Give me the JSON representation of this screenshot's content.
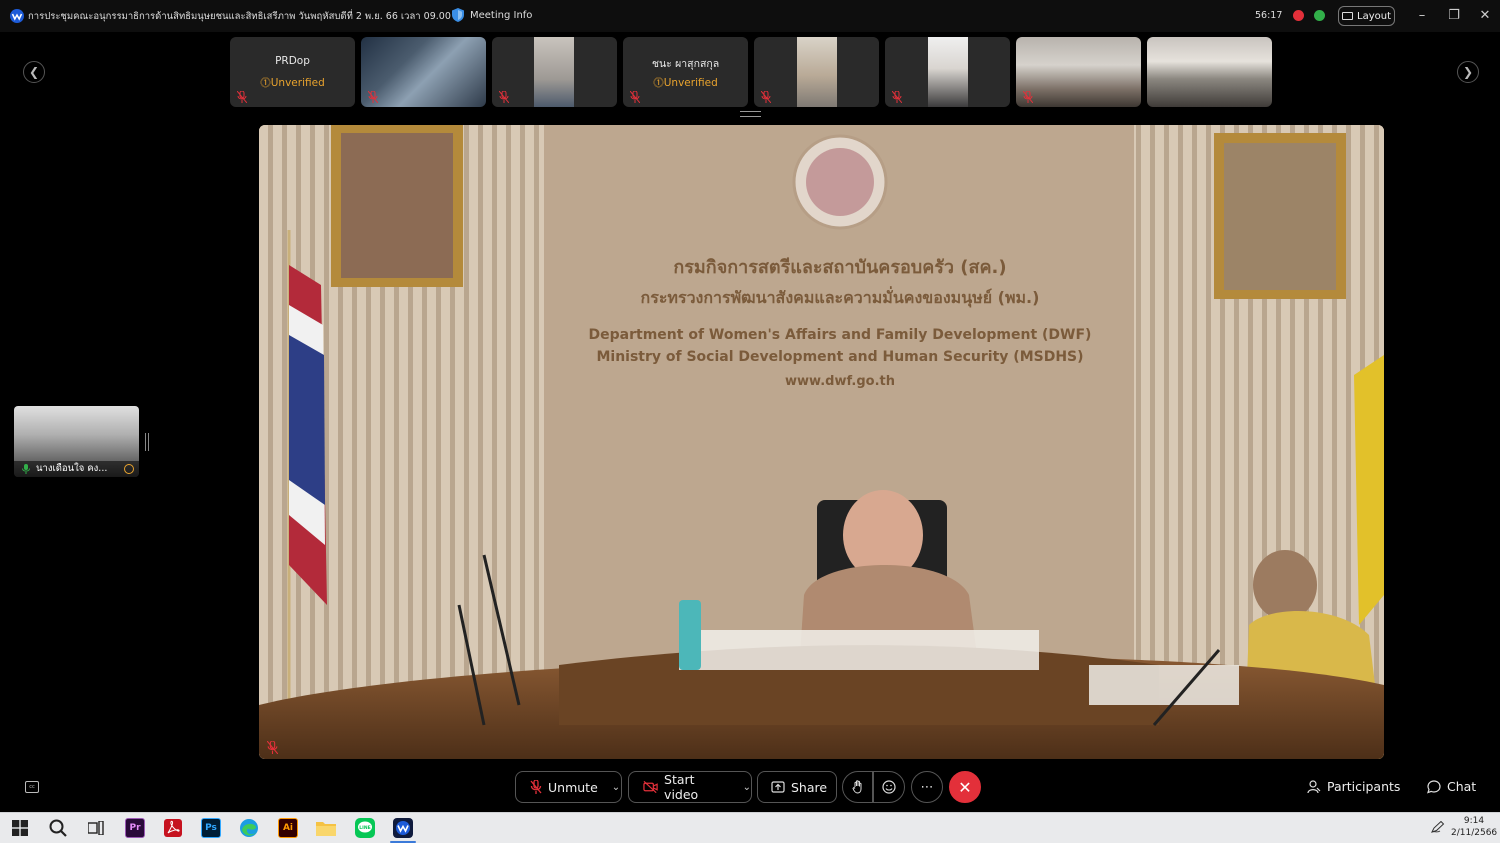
{
  "window": {
    "title": "การประชุมคณะอนุกรรมาธิการด้านสิทธิมนุษยชนและสิทธิเสรีภาพ วันพฤหัสบดีที่ 2 พ.ย. 66 เวลา 09.00 น.",
    "meeting_info_label": "Meeting Info",
    "timer": "56:17",
    "layout_label": "Layout",
    "controls": {
      "minimize": "–",
      "maximize": "❐",
      "close": "✕"
    }
  },
  "thumbnails": [
    {
      "name": "PRDop",
      "status": "Unverified",
      "has_video": false
    },
    {
      "name": "",
      "status": "",
      "has_video": true
    },
    {
      "name": "",
      "status": "",
      "has_video": true
    },
    {
      "name": "ชนะ ผาสุกสกุล",
      "status": "Unverified",
      "has_video": false
    },
    {
      "name": "",
      "status": "",
      "has_video": true
    },
    {
      "name": "",
      "status": "",
      "has_video": true
    },
    {
      "name": "",
      "status": "",
      "has_video": true
    },
    {
      "name": "",
      "status": "",
      "has_video": true
    }
  ],
  "self_view": {
    "name": "นางเดือนใจ คง..."
  },
  "main_video": {
    "sign_line_1": "กรมกิจการสตรีและสถาบันครอบครัว (สค.)",
    "sign_line_2": "กระทรวงการพัฒนาสังคมและความมั่นคงของมนุษย์ (พม.)",
    "sign_line_3": "Department of Women's Affairs and Family Development (DWF)",
    "sign_line_4": "Ministry of Social Development and Human Security (MSDHS)",
    "sign_line_5": "www.dwf.go.th"
  },
  "controls": {
    "unmute": "Unmute",
    "start_video": "Start video",
    "share": "Share",
    "participants": "Participants",
    "chat": "Chat",
    "cc": "cc"
  },
  "taskbar": {
    "time": "9:14",
    "date": "2/11/2566",
    "apps": [
      {
        "name": "start-icon",
        "label": ""
      },
      {
        "name": "search-icon",
        "label": ""
      },
      {
        "name": "task-view-icon",
        "label": ""
      },
      {
        "name": "premiere-icon",
        "label": "Pr"
      },
      {
        "name": "acrobat-icon",
        "label": ""
      },
      {
        "name": "photoshop-icon",
        "label": "Ps"
      },
      {
        "name": "edge-icon",
        "label": ""
      },
      {
        "name": "illustrator-icon",
        "label": "Ai"
      },
      {
        "name": "file-explorer-icon",
        "label": ""
      },
      {
        "name": "line-icon",
        "label": "LINE"
      },
      {
        "name": "webex-icon",
        "label": ""
      }
    ]
  },
  "colors": {
    "accent_warning": "#e8a32e",
    "leave_red": "#e3303a",
    "record_red": "#e3303a",
    "record_green": "#32b04a",
    "taskbar_bg": "#e9eaec"
  }
}
